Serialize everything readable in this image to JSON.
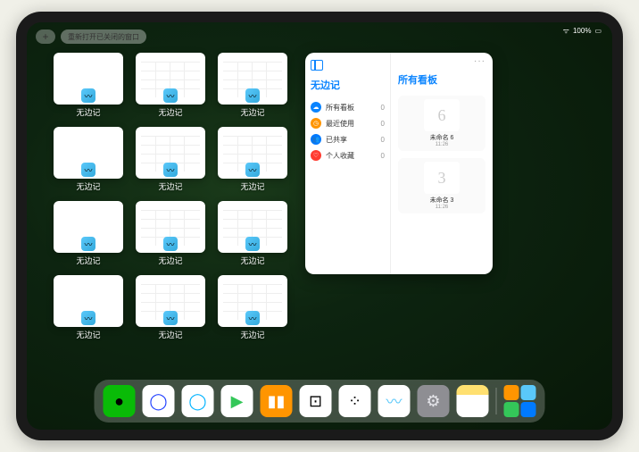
{
  "status": {
    "battery": "100%"
  },
  "topbar": {
    "add": "+",
    "reopen": "重新打开已关闭的窗口"
  },
  "windows": [
    {
      "label": "无边记",
      "content": "blank"
    },
    {
      "label": "无边记",
      "content": "grid"
    },
    {
      "label": "无边记",
      "content": "grid"
    },
    {
      "label": "无边记",
      "content": "blank"
    },
    {
      "label": "无边记",
      "content": "grid"
    },
    {
      "label": "无边记",
      "content": "grid"
    },
    {
      "label": "无边记",
      "content": "blank"
    },
    {
      "label": "无边记",
      "content": "grid"
    },
    {
      "label": "无边记",
      "content": "grid"
    },
    {
      "label": "无边记",
      "content": "blank"
    },
    {
      "label": "无边记",
      "content": "grid"
    },
    {
      "label": "无边记",
      "content": "grid"
    }
  ],
  "preview": {
    "left_title": "无边记",
    "right_title": "所有看板",
    "more": "···",
    "items": [
      {
        "icon_bg": "#0a84ff",
        "glyph": "☁",
        "label": "所有看板",
        "count": 0
      },
      {
        "icon_bg": "#ff9500",
        "glyph": "◷",
        "label": "最近使用",
        "count": 0
      },
      {
        "icon_bg": "#007aff",
        "glyph": "👥",
        "label": "已共享",
        "count": 0
      },
      {
        "icon_bg": "#ff3b30",
        "glyph": "♡",
        "label": "个人收藏",
        "count": 0
      }
    ],
    "cards": [
      {
        "sketch": "6",
        "label": "未命名 6",
        "sub": "11:26"
      },
      {
        "sketch": "3",
        "label": "未命名 3",
        "sub": "11:26"
      }
    ]
  },
  "dock": {
    "apps": [
      {
        "name": "wechat",
        "bg": "#09bb07",
        "glyph": "●"
      },
      {
        "name": "quark",
        "bg": "#ffffff",
        "glyph": "◯",
        "fg": "#1e3eff"
      },
      {
        "name": "browser",
        "bg": "#ffffff",
        "glyph": "◯",
        "fg": "#00b3ff"
      },
      {
        "name": "video",
        "bg": "#ffffff",
        "glyph": "▶",
        "fg": "#34c759"
      },
      {
        "name": "books",
        "bg": "#ff9500",
        "glyph": "▮▮",
        "fg": "#fff"
      },
      {
        "name": "dice",
        "bg": "#ffffff",
        "glyph": "⊡",
        "fg": "#000"
      },
      {
        "name": "pattern",
        "bg": "#ffffff",
        "glyph": "⁘",
        "fg": "#000"
      },
      {
        "name": "freeform",
        "bg": "#ffffff",
        "glyph": "〰",
        "fg": "#5ac8fa"
      },
      {
        "name": "settings",
        "bg": "#8e8e93",
        "glyph": "⚙",
        "fg": "#e5e5ea"
      },
      {
        "name": "notes",
        "bg": "linear-gradient(#ffe070 30%,#fff 30%)",
        "glyph": "",
        "fg": "#000"
      }
    ]
  }
}
